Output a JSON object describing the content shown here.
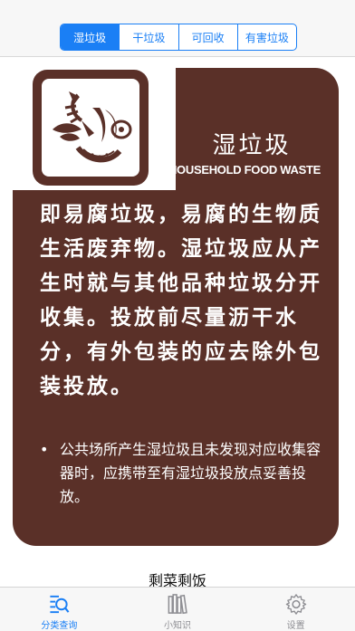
{
  "segments": [
    {
      "label": "湿垃圾",
      "active": true
    },
    {
      "label": "干垃圾",
      "active": false
    },
    {
      "label": "可回收",
      "active": false
    },
    {
      "label": "有害垃圾",
      "active": false
    }
  ],
  "card": {
    "icon": "food-waste-icon",
    "title": "湿垃圾",
    "subtitle": "HOUSEHOLD FOOD WASTE",
    "description": "即易腐垃圾，易腐的生物质生活废弃物。湿垃圾应从产生时就与其他品种垃圾分开收集。投放前尽量沥干水分，有外包装的应去除外包装投放。",
    "note": "公共场所产生湿垃圾且未发现对应收集容器时，应携带至有湿垃圾投放点妥善投放。",
    "colors": {
      "background": "#5a3028",
      "text": "#ffffff"
    }
  },
  "item_name": "剩菜剩饭",
  "tabbar": [
    {
      "label": "分类查询",
      "icon": "search-list-icon",
      "active": true
    },
    {
      "label": "小知识",
      "icon": "books-icon",
      "active": false
    },
    {
      "label": "设置",
      "icon": "gear-icon",
      "active": false
    }
  ],
  "accent_color": "#1a7ff5"
}
